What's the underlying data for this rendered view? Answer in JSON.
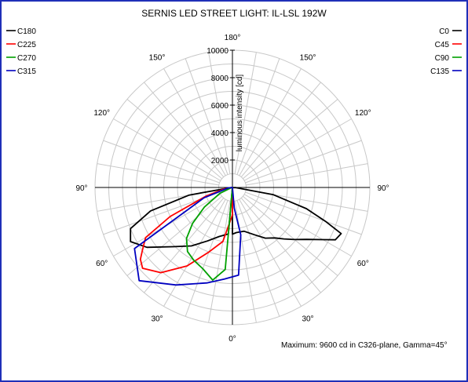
{
  "chart_data": {
    "type": "polar",
    "title": "SERNIS LED STREET LIGHT: IL-LSL 192W",
    "radial_label": "luminous intensity [cd]",
    "radial_ticks": [
      2000,
      4000,
      6000,
      8000,
      10000
    ],
    "rmax": 10000,
    "angle_labels": [
      "180°",
      "150°",
      "120°",
      "90°",
      "60°",
      "30°",
      "0°",
      "30°",
      "60°",
      "90°",
      "120°",
      "150°"
    ],
    "footer": "Maximum: 9600 cd in C326-plane, Gamma=45°",
    "grid": "on",
    "legend_left": [
      {
        "name": "C180",
        "color": "#000000"
      },
      {
        "name": "C225",
        "color": "#ff0000"
      },
      {
        "name": "C270",
        "color": "#00a000"
      },
      {
        "name": "C315",
        "color": "#0000c0"
      }
    ],
    "legend_right": [
      {
        "name": "C0",
        "color": "#000000"
      },
      {
        "name": "C45",
        "color": "#ff0000"
      },
      {
        "name": "C90",
        "color": "#00a000"
      },
      {
        "name": "C135",
        "color": "#0000c0"
      }
    ],
    "series": [
      {
        "name": "C0-C180",
        "color": "#000000",
        "points": [
          [
            0,
            0
          ],
          [
            -5,
            3400
          ],
          [
            -15,
            3700
          ],
          [
            -25,
            4300
          ],
          [
            -35,
            5200
          ],
          [
            -45,
            6100
          ],
          [
            -55,
            7600
          ],
          [
            -62,
            8400
          ],
          [
            -68,
            8000
          ],
          [
            -74,
            6200
          ],
          [
            -80,
            3200
          ],
          [
            -88,
            100
          ],
          [
            88,
            250
          ],
          [
            80,
            3000
          ],
          [
            74,
            5600
          ],
          [
            70,
            7200
          ],
          [
            67,
            8600
          ],
          [
            63,
            8400
          ],
          [
            60,
            7600
          ],
          [
            55,
            6600
          ],
          [
            50,
            5900
          ],
          [
            45,
            5300
          ],
          [
            40,
            4800
          ],
          [
            33,
            4400
          ],
          [
            25,
            3800
          ],
          [
            15,
            3300
          ],
          [
            5,
            3300
          ],
          [
            0,
            3400
          ]
        ]
      },
      {
        "name": "C45-C225",
        "color": "#ff0000",
        "points": [
          [
            0,
            2000
          ],
          [
            -10,
            4000
          ],
          [
            -20,
            5000
          ],
          [
            -30,
            6600
          ],
          [
            -40,
            8100
          ],
          [
            -48,
            8800
          ],
          [
            -52,
            8500
          ],
          [
            -55,
            8000
          ],
          [
            -60,
            7300
          ],
          [
            -65,
            5000
          ],
          [
            -72,
            2000
          ],
          [
            -80,
            600
          ],
          [
            -88,
            0
          ],
          [
            0,
            0
          ]
        ]
      },
      {
        "name": "C90-C270",
        "color": "#00a000",
        "points": [
          [
            0,
            0
          ],
          [
            -5,
            6000
          ],
          [
            -12,
            6900
          ],
          [
            -20,
            6300
          ],
          [
            -28,
            6000
          ],
          [
            -35,
            5700
          ],
          [
            -42,
            5000
          ],
          [
            -48,
            3900
          ],
          [
            -55,
            2500
          ],
          [
            -65,
            1000
          ],
          [
            -78,
            100
          ],
          [
            0,
            0
          ]
        ]
      },
      {
        "name": "C135-C315",
        "color": "#0000c0",
        "points": [
          [
            0,
            0
          ],
          [
            5,
            1500
          ],
          [
            10,
            3500
          ],
          [
            4,
            6400
          ],
          [
            -5,
            6700
          ],
          [
            -15,
            7200
          ],
          [
            -30,
            8200
          ],
          [
            -45,
            9600
          ],
          [
            -58,
            8400
          ],
          [
            -70,
            2200
          ],
          [
            -85,
            300
          ],
          [
            0,
            0
          ]
        ]
      }
    ]
  }
}
